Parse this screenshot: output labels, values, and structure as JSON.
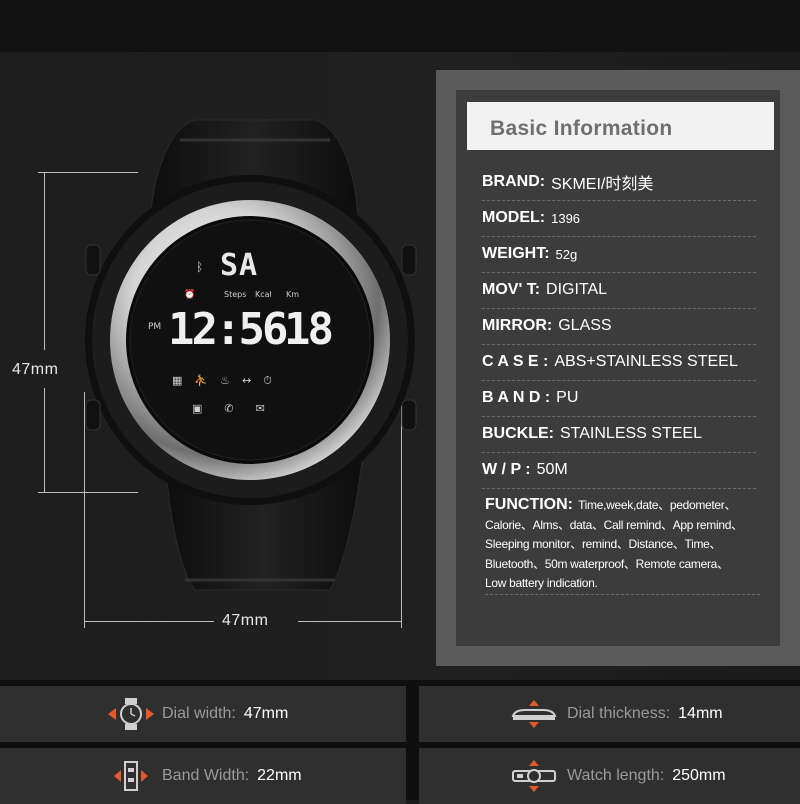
{
  "dimensions": {
    "height_label": "47mm",
    "width_label": "47mm"
  },
  "watch": {
    "status_top": "SA",
    "labels": [
      "Steps",
      "Kcal",
      "Km"
    ],
    "ampm": "PM",
    "time": "12:56",
    "seconds": "18",
    "icons": [
      "calendar-icon",
      "running-icon",
      "flame-icon",
      "distance-icon",
      "stopwatch-icon",
      "camera-icon",
      "phone-icon",
      "mail-icon"
    ]
  },
  "info": {
    "title": "Basic Information",
    "specs": [
      {
        "key": "BRAND:",
        "value": "SKMEI/时刻美"
      },
      {
        "key": "MODEL:",
        "value": "1396"
      },
      {
        "key": "WEIGHT:",
        "value": "52g"
      },
      {
        "key": "MOV' T:",
        "value": "DIGITAL"
      },
      {
        "key": "MIRROR:",
        "value": "GLASS"
      },
      {
        "key": "C A S E :",
        "value": "ABS+STAINLESS STEEL"
      },
      {
        "key": "B A N D :",
        "value": "PU"
      },
      {
        "key": "BUCKLE:",
        "value": "STAINLESS STEEL"
      },
      {
        "key": "W / P :",
        "value": "50M"
      }
    ],
    "function_key": "FUNCTION:",
    "function_lines": [
      "Time,week,date、pedometer、",
      "Calorie、Alms、data、Call remind、App remind、",
      "Sleeping monitor、remind、Distance、Time、",
      "Bluetooth、50m waterproof、Remote camera、",
      "Low battery indication."
    ]
  },
  "features": [
    {
      "label": "Dial width:",
      "value": "47mm",
      "icon": "dial-width-icon"
    },
    {
      "label": "Dial thickness:",
      "value": "14mm",
      "icon": "dial-thickness-icon"
    },
    {
      "label": "Band Width:",
      "value": "22mm",
      "icon": "band-width-icon"
    },
    {
      "label": "Watch length:",
      "value": "250mm",
      "icon": "watch-length-icon"
    }
  ],
  "colors": {
    "accent": "#e3592a",
    "panel": "#3c3c3c",
    "header": "#f2f2f2"
  }
}
